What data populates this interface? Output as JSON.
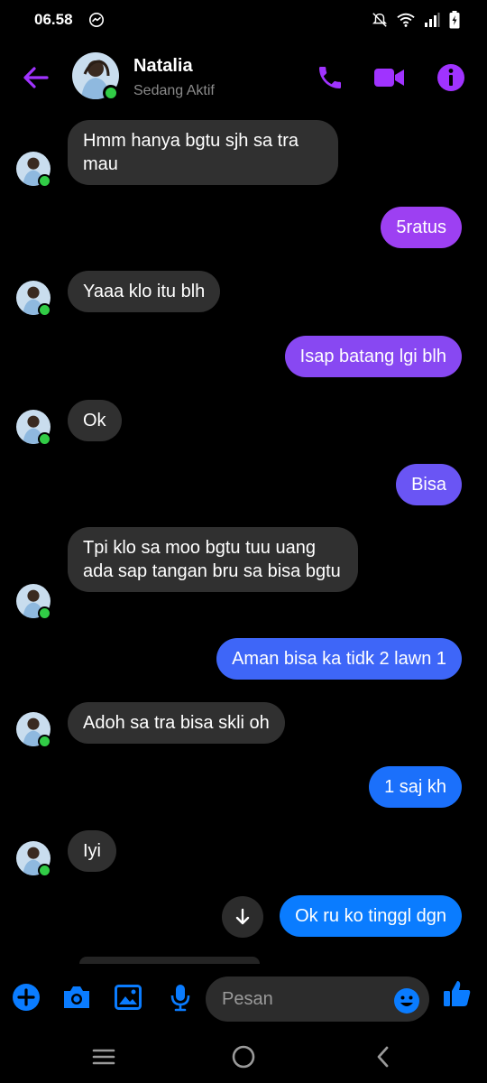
{
  "status_bar": {
    "time": "06.58"
  },
  "header": {
    "name": "Natalia",
    "status": "Sedang Aktif"
  },
  "messages": [
    {
      "side": "in",
      "text": "Hmm hanya bgtu sjh sa tra mau"
    },
    {
      "side": "out",
      "text": "5ratus"
    },
    {
      "side": "in",
      "text": "Yaaa klo itu blh"
    },
    {
      "side": "out",
      "text": "Isap batang lgi blh"
    },
    {
      "side": "in",
      "text": "Ok"
    },
    {
      "side": "out",
      "text": "Bisa"
    },
    {
      "side": "in",
      "text": "Tpi klo sa moo bgtu tuu uang ada sap tangan bru sa bisa bgtu"
    },
    {
      "side": "out",
      "text": "Aman bisa ka tidk 2 lawn 1"
    },
    {
      "side": "in",
      "text": "Adoh sa tra bisa skli oh"
    },
    {
      "side": "out",
      "text": "1 saj kh"
    },
    {
      "side": "in",
      "text": "Iyi"
    },
    {
      "side": "out",
      "text": "Ok ru ko tinggl dgn"
    }
  ],
  "composer": {
    "placeholder": "Pesan"
  },
  "icons": {
    "back": "arrow-left-icon",
    "call": "phone-icon",
    "video": "video-camera-icon",
    "info": "info-icon",
    "add": "plus-icon",
    "camera": "camera-icon",
    "gallery": "image-icon",
    "mic": "microphone-icon",
    "emoji": "emoji-icon",
    "like": "thumbs-up-icon",
    "scroll": "arrow-down-icon"
  },
  "colors": {
    "accent_purple": "#a033ff",
    "accent_blue": "#0a7cff",
    "incoming_bubble": "#303030",
    "background": "#000000",
    "online_green": "#31cc46"
  }
}
